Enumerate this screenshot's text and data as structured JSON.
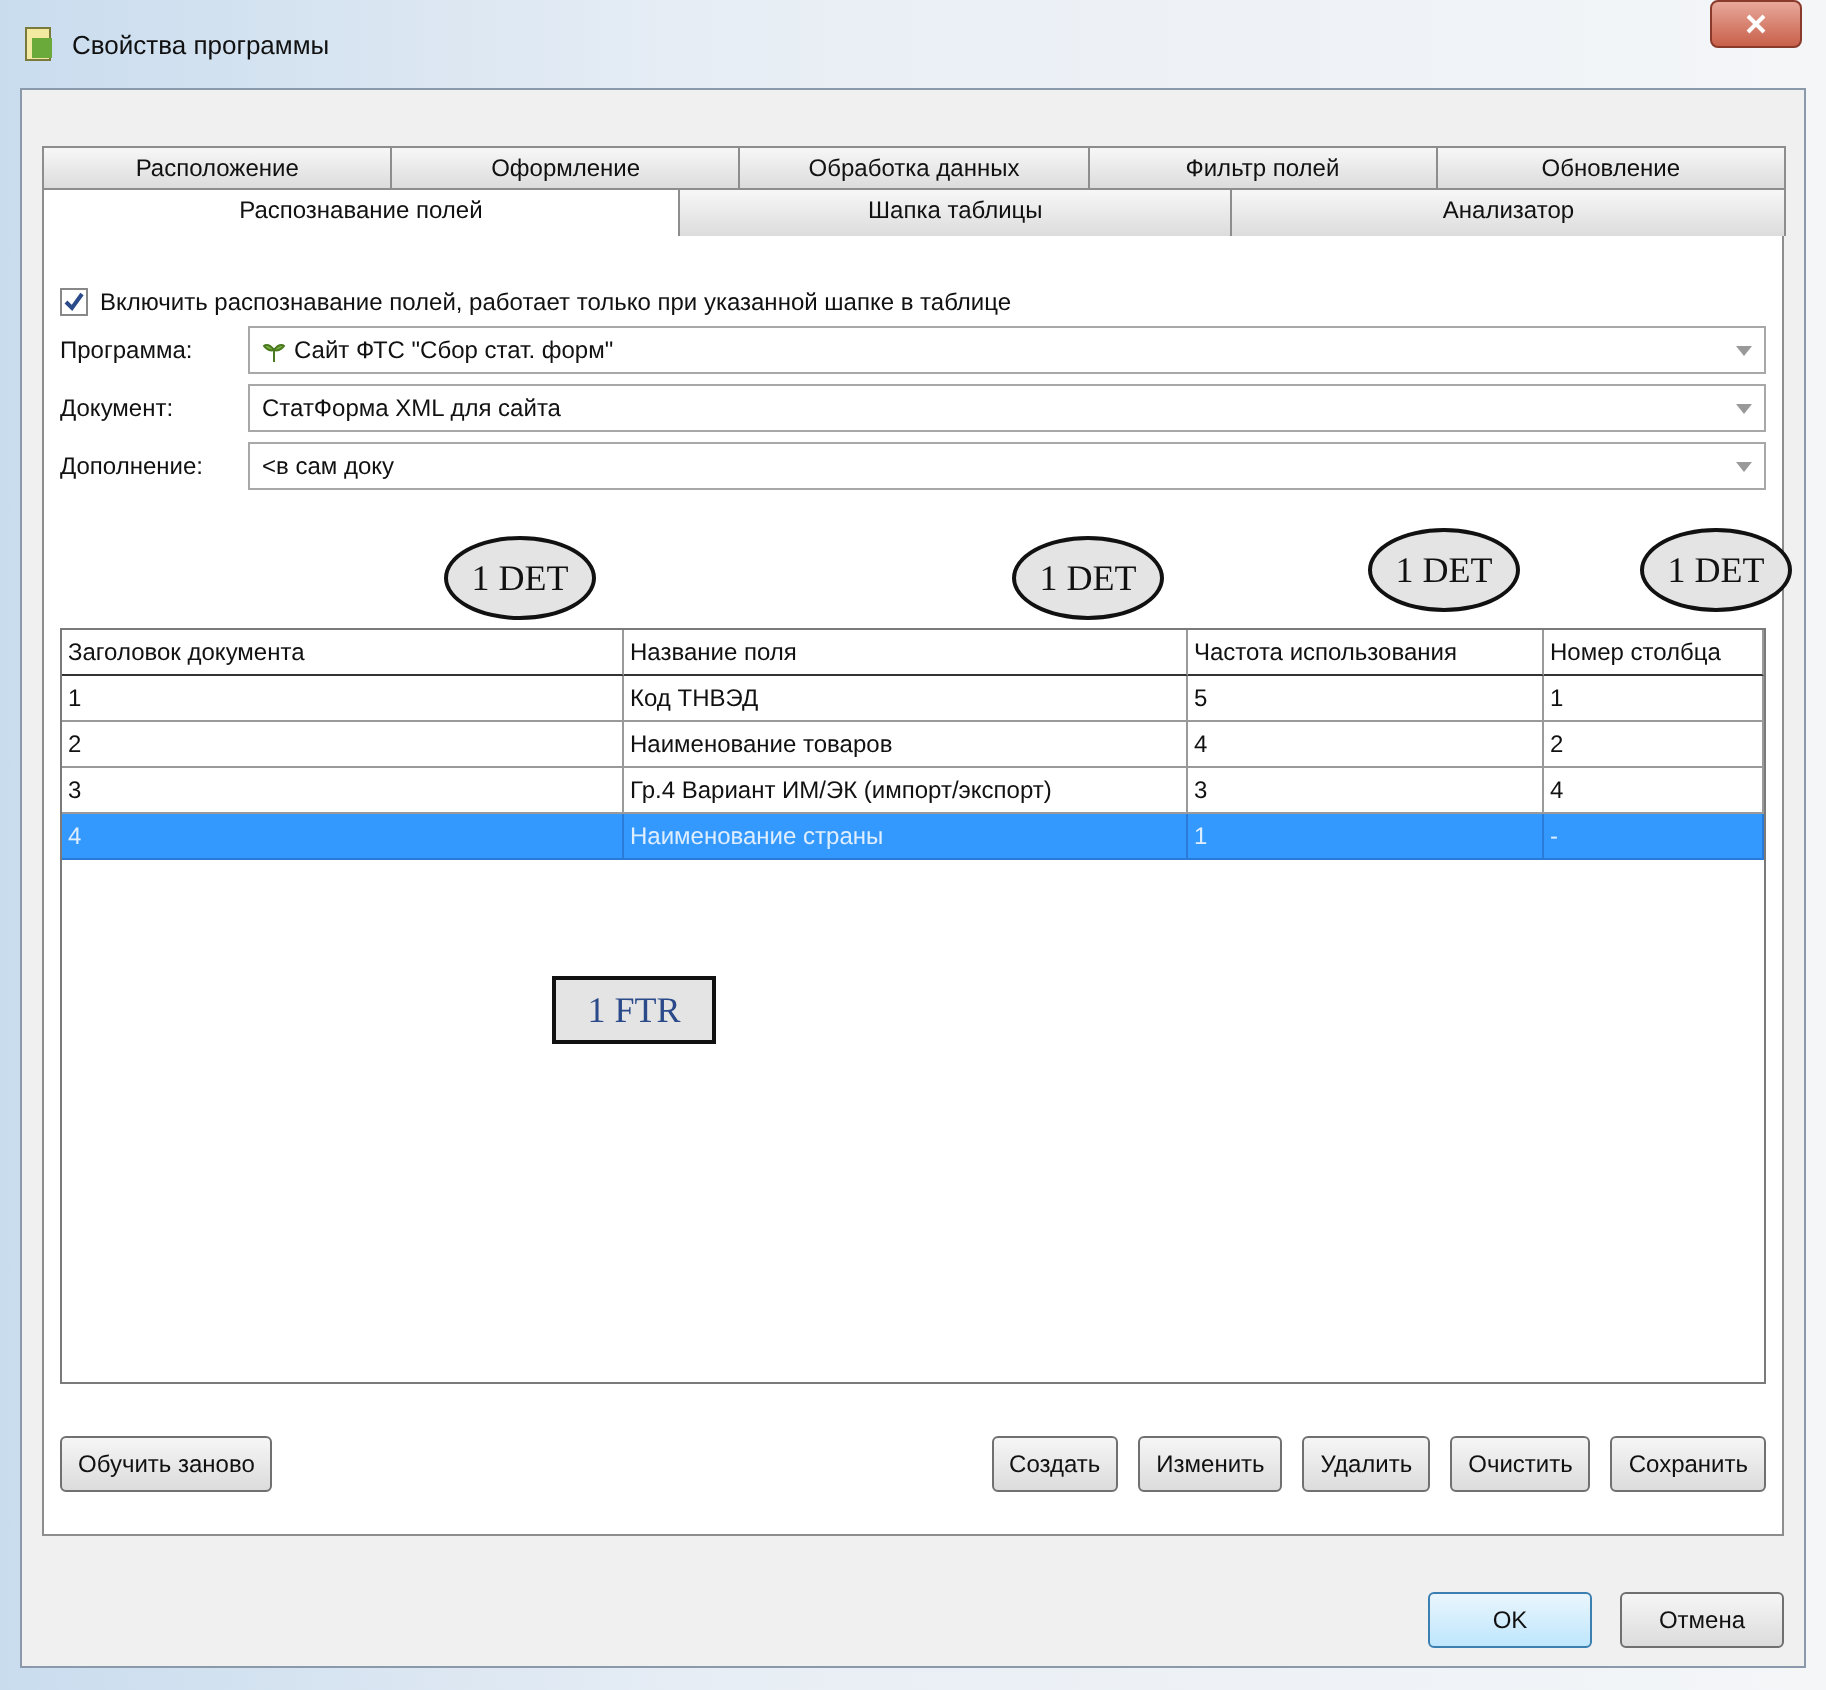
{
  "window": {
    "title": "Свойства программы"
  },
  "tab_rows": [
    [
      {
        "label": "Расположение",
        "selected": false
      },
      {
        "label": "Оформление",
        "selected": false
      },
      {
        "label": "Обработка данных",
        "selected": false
      },
      {
        "label": "Фильтр полей",
        "selected": false
      },
      {
        "label": "Обновление",
        "selected": false
      }
    ],
    [
      {
        "label": "Распознавание полей",
        "selected": true
      },
      {
        "label": "Шапка таблицы",
        "selected": false
      },
      {
        "label": "Анализатор",
        "selected": false
      }
    ]
  ],
  "enable_checkbox": {
    "label": "Включить распознавание полей, работает только при  указанной шапке в таблице",
    "checked": true
  },
  "fields": [
    {
      "label": "Программа:",
      "value": "Сайт ФТС \"Сбор стат. форм\"",
      "icon": true
    },
    {
      "label": "Документ:",
      "value": "СтатФорма XML для сайта",
      "icon": false
    },
    {
      "label": "Дополнение:",
      "value": "<в сам доку",
      "icon": false
    }
  ],
  "table": {
    "columns": [
      "Заголовок документа",
      "Название поля",
      "Частота использования",
      "Номер столбца"
    ],
    "rows": [
      {
        "cells": [
          "1",
          "Код ТНВЭД",
          "5",
          "1"
        ],
        "selected": false
      },
      {
        "cells": [
          "2",
          "Наименование товаров",
          "4",
          "2"
        ],
        "selected": false
      },
      {
        "cells": [
          "3",
          "Гр.4 Вариант ИМ/ЭК (импорт/экспорт)",
          "3",
          "4"
        ],
        "selected": false
      },
      {
        "cells": [
          "4",
          "Наименование страны",
          "1",
          "-"
        ],
        "selected": true
      }
    ]
  },
  "left_button": "Обучить заново",
  "right_buttons": [
    "Создать",
    "Изменить",
    "Удалить",
    "Очистить",
    "Сохранить"
  ],
  "dialog_buttons": [
    {
      "label": "OK",
      "default": true
    },
    {
      "label": "Отмена",
      "default": false
    }
  ],
  "annotations": [
    {
      "kind": "ellipse",
      "text": "1 DET"
    },
    {
      "kind": "ellipse",
      "text": "1 DET"
    },
    {
      "kind": "ellipse",
      "text": "1 DET"
    },
    {
      "kind": "ellipse",
      "text": "1 DET"
    },
    {
      "kind": "box",
      "text": "1 FTR"
    }
  ]
}
